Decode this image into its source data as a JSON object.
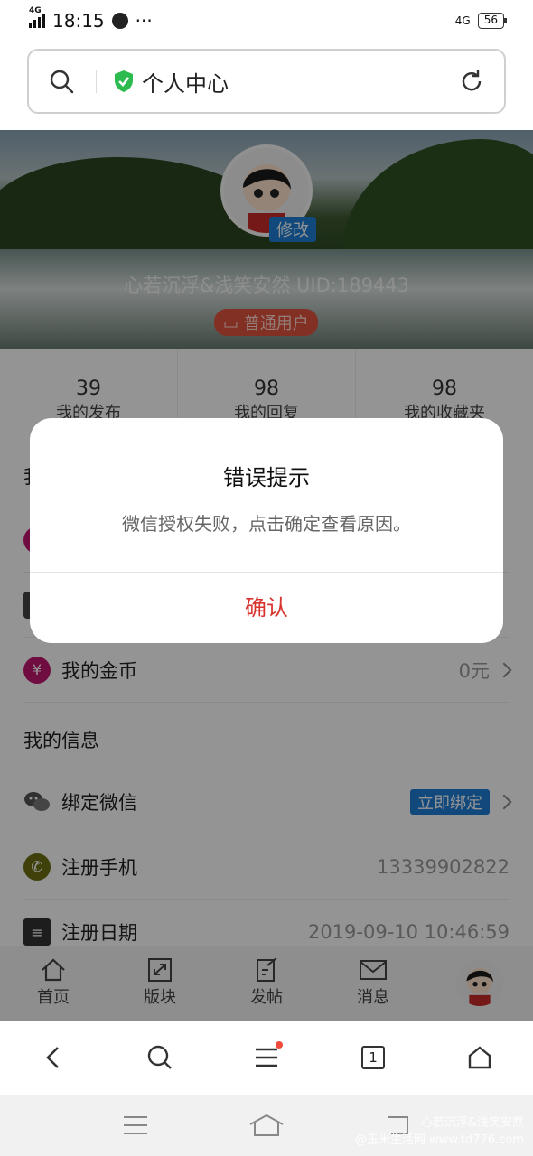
{
  "status_bar": {
    "time": "18:15",
    "network_left": "4G",
    "network_right": "4G",
    "battery": "56"
  },
  "address_bar": {
    "title": "个人中心"
  },
  "profile": {
    "edit_label": "修改",
    "username": "心若沉浮&浅笑安然 UID:189443",
    "user_type": "普通用户"
  },
  "stats": [
    {
      "value": "39",
      "label": "我的发布"
    },
    {
      "value": "98",
      "label": "我的回复"
    },
    {
      "value": "98",
      "label": "我的收藏夹"
    }
  ],
  "list": {
    "partial_section_title": "我",
    "coins": {
      "label": "我的金币",
      "value": "0元",
      "icon": "yen-icon"
    },
    "info_title": "我的信息",
    "wechat": {
      "label": "绑定微信",
      "action": "立即绑定",
      "icon": "wechat-icon"
    },
    "phone": {
      "label": "注册手机",
      "value": "13339902822",
      "icon": "phone-icon"
    },
    "date": {
      "label": "注册日期",
      "value": "2019-09-10 10:46:59",
      "icon": "calendar-icon"
    }
  },
  "app_nav": [
    {
      "label": "首页",
      "icon": "home-icon"
    },
    {
      "label": "版块",
      "icon": "expand-icon"
    },
    {
      "label": "发帖",
      "icon": "compose-icon"
    },
    {
      "label": "消息",
      "icon": "mail-icon"
    }
  ],
  "dialog": {
    "title": "错误提示",
    "message": "微信授权失败，点击确定查看原因。",
    "confirm": "确认"
  },
  "browser_bar": {
    "tab_count": "1"
  },
  "watermark": {
    "line1": "心若沉浮&浅笑安然",
    "line2": "@玉米生活网 www.td776.com"
  },
  "colors": {
    "accent_red": "#d8322f",
    "badge_blue": "#1e7fd8",
    "tag_red": "#e2533f"
  }
}
